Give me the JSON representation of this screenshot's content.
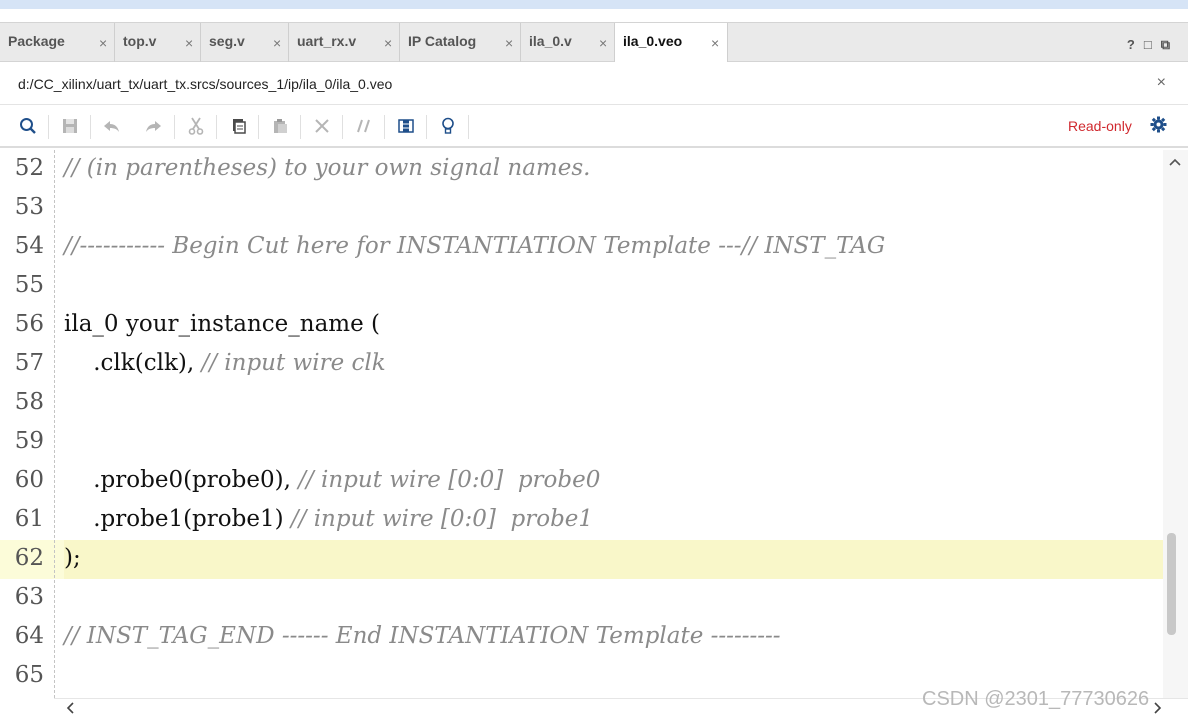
{
  "tabs": [
    {
      "label": "Package",
      "close": "×",
      "active": false
    },
    {
      "label": "top.v",
      "close": "×",
      "active": false
    },
    {
      "label": "seg.v",
      "close": "×",
      "active": false
    },
    {
      "label": "uart_rx.v",
      "close": "×",
      "active": false
    },
    {
      "label": "IP Catalog",
      "close": "×",
      "active": false
    },
    {
      "label": "ila_0.v",
      "close": "×",
      "active": false
    },
    {
      "label": "ila_0.veo",
      "close": "×",
      "active": true
    }
  ],
  "window_controls": {
    "help": "?",
    "maximize": "□",
    "float": "⧉"
  },
  "path": {
    "text": "d:/CC_xilinx/uart_tx/uart_tx.srcs/sources_1/ip/ila_0/ila_0.veo",
    "close": "×"
  },
  "toolbar": {
    "readonly_label": "Read-only",
    "icons": [
      "search-icon",
      "save-icon",
      "undo-icon",
      "redo-icon",
      "cut-icon",
      "copy-icon",
      "paste-icon",
      "delete-icon",
      "comment-icon",
      "column-select-icon",
      "lightbulb-icon",
      "gear-icon"
    ]
  },
  "editor": {
    "lines": [
      {
        "num": "52",
        "code": "",
        "comment": "// (in parentheses) to your own signal names."
      },
      {
        "num": "53",
        "code": "",
        "comment": ""
      },
      {
        "num": "54",
        "code": "",
        "comment": "//----------- Begin Cut here for INSTANTIATION Template ---// INST_TAG"
      },
      {
        "num": "55",
        "code": "",
        "comment": ""
      },
      {
        "num": "56",
        "code": "ila_0 your_instance_name (",
        "comment": ""
      },
      {
        "num": "57",
        "code": "    .clk(clk), ",
        "comment": "// input wire clk"
      },
      {
        "num": "58",
        "code": "",
        "comment": ""
      },
      {
        "num": "59",
        "code": "",
        "comment": ""
      },
      {
        "num": "60",
        "code": "    .probe0(probe0), ",
        "comment": "// input wire [0:0]  probe0"
      },
      {
        "num": "61",
        "code": "    .probe1(probe1) ",
        "comment": "// input wire [0:0]  probe1"
      },
      {
        "num": "62",
        "code": ");",
        "comment": "",
        "highlight": true
      },
      {
        "num": "63",
        "code": "",
        "comment": ""
      },
      {
        "num": "64",
        "code": "",
        "comment": "// INST_TAG_END ------ End INSTANTIATION Template ---------"
      },
      {
        "num": "65",
        "code": "",
        "comment": ""
      }
    ]
  },
  "watermark": "CSDN @2301_77730626",
  "colors": {
    "readonly": "#d0282e",
    "highlight": "#f9f7c9",
    "comment": "#8a8a8a",
    "accent": "#1f4f8a"
  }
}
